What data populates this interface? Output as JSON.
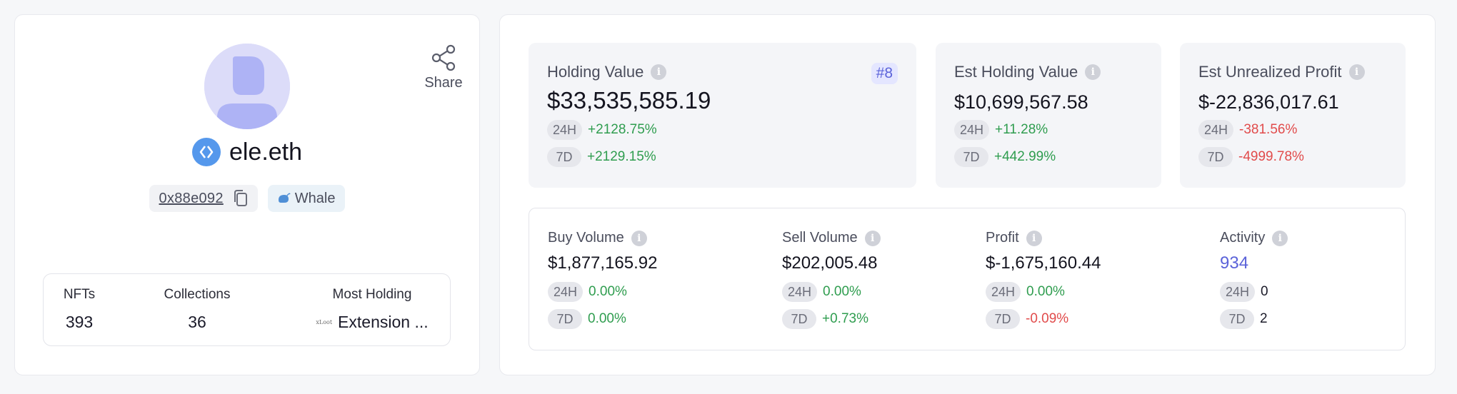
{
  "profile": {
    "share_label": "Share",
    "name": "ele.eth",
    "address": "0x88e092",
    "badge": "Whale",
    "holdings": {
      "nfts_label": "NFTs",
      "nfts_value": "393",
      "collections_label": "Collections",
      "collections_value": "36",
      "most_label": "Most Holding",
      "most_logo_text": "xLoot",
      "most_value": "Extension ..."
    }
  },
  "holding_value": {
    "label": "Holding Value",
    "rank": "#8",
    "value": "$33,535,585.19",
    "d24_tag": "24H",
    "d24": "+2128.75%",
    "d7_tag": "7D",
    "d7": "+2129.15%"
  },
  "est_holding_value": {
    "label": "Est Holding Value",
    "value": "$10,699,567.58",
    "d24_tag": "24H",
    "d24": "+11.28%",
    "d7_tag": "7D",
    "d7": "+442.99%"
  },
  "est_unrealized_profit": {
    "label": "Est Unrealized Profit",
    "value": "$-22,836,017.61",
    "d24_tag": "24H",
    "d24": "-381.56%",
    "d7_tag": "7D",
    "d7": "-4999.78%"
  },
  "buy_volume": {
    "label": "Buy Volume",
    "value": "$1,877,165.92",
    "d24_tag": "24H",
    "d24": "0.00%",
    "d7_tag": "7D",
    "d7": "0.00%"
  },
  "sell_volume": {
    "label": "Sell Volume",
    "value": "$202,005.48",
    "d24_tag": "24H",
    "d24": "0.00%",
    "d7_tag": "7D",
    "d7": "+0.73%"
  },
  "profit": {
    "label": "Profit",
    "value": "$-1,675,160.44",
    "d24_tag": "24H",
    "d24": "0.00%",
    "d7_tag": "7D",
    "d7": "-0.09%"
  },
  "activity": {
    "label": "Activity",
    "value": "934",
    "d24_tag": "24H",
    "d24": "0",
    "d7_tag": "7D",
    "d7": "2"
  },
  "colors": {
    "positive": "#2f9d4f",
    "negative": "#e14b4b",
    "accent": "#5b63d9",
    "avatar_bg": "#dcdcf9",
    "ens_blue": "#5598ec"
  }
}
